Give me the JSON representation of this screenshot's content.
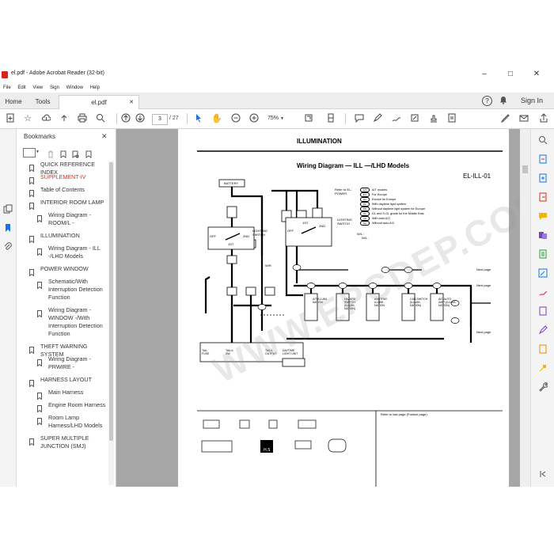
{
  "window": {
    "title": "el.pdf - Adobe Acrobat Reader (32-bit)",
    "minimize": "–",
    "maximize": "□",
    "close": "✕"
  },
  "menu": [
    "File",
    "Edit",
    "View",
    "Sign",
    "Window",
    "Help"
  ],
  "tabs": {
    "home": "Home",
    "tools": "Tools",
    "doc": "el.pdf",
    "doc_close": "✕",
    "help": "?",
    "bell": "🔔",
    "signin": "Sign In"
  },
  "toolbar": {
    "page_current": "3",
    "page_sep": "/",
    "page_total": "27",
    "zoom": "75%"
  },
  "bookmarks": {
    "title": "Bookmarks",
    "close": "✕",
    "items": [
      {
        "label": "QUICK REFERENCE INDEX",
        "level": 0,
        "color": "#333"
      },
      {
        "label": "SUPPLEMENT-IV",
        "level": 0,
        "color": "#d6311f"
      },
      {
        "label": "Table of Contents",
        "level": 0,
        "color": "#333"
      },
      {
        "label": "INTERIOR ROOM LAMP",
        "level": 0,
        "color": "#333"
      },
      {
        "label": "Wiring Diagram - ROOM/L -",
        "level": 1,
        "color": "#333"
      },
      {
        "label": "ILLUMINATION",
        "level": 0,
        "color": "#333"
      },
      {
        "label": "Wiring Diagram - ILL -/LHD Models",
        "level": 1,
        "color": "#333"
      },
      {
        "label": "POWER WINDOW",
        "level": 0,
        "color": "#333"
      },
      {
        "label": "Schematic/With Interruption Detection Function",
        "level": 1,
        "color": "#333"
      },
      {
        "label": "Wiring Diagram - WINDOW -/With Interruption Detection Function",
        "level": 1,
        "color": "#333"
      },
      {
        "label": "THEFT WARNING SYSTEM",
        "level": 0,
        "color": "#333"
      },
      {
        "label": "Wiring Diagram - PRWIRE -",
        "level": 1,
        "color": "#333"
      },
      {
        "label": "HARNESS LAYOUT",
        "level": 0,
        "color": "#333"
      },
      {
        "label": "Main Harness",
        "level": 1,
        "color": "#333"
      },
      {
        "label": "Engine Room Harness",
        "level": 1,
        "color": "#333"
      },
      {
        "label": "Room Lamp Harness/LHD Models",
        "level": 1,
        "color": "#333"
      },
      {
        "label": "SUPER MULTIPLE JUNCTION (SMJ)",
        "level": 0,
        "color": "#333"
      }
    ]
  },
  "doc": {
    "header": "ILLUMINATION",
    "title": "Wiring Diagram — ILL —/LHD Models",
    "code": "EL-ILL-01",
    "battery": "BATTERY",
    "refer_power": "Refer to EL-POWER.",
    "lighting_switch": "LIGHTING SWITCH",
    "off": "OFF",
    "first": "1ST",
    "second": "2ND",
    "wr": "W/R",
    "next_page_1": "Next page",
    "next_page_2": "Next page",
    "next_page_3": "Next page",
    "components": [
      "A/T ILLUMI-NATION",
      "HAZARD SWITCH (ILLUMI-NATION)",
      "ASHTRAY ILLUMI-NATION",
      "CAN SWITCH (ILLUMI-NATION)",
      "A/C AUTO AMP (ILLUMI-NATION)"
    ],
    "bottom_labels": [
      "TAIL FUSE",
      "TAIL/L SW",
      "TAIL/L OUTPUT",
      "DAYTIME LIGHT UNIT"
    ],
    "legend": [
      {
        "code": "A/T",
        "text": "A/T models"
      },
      {
        "code": "EU",
        "text": "For Europe"
      },
      {
        "code": "EX",
        "text": "Except for Europe"
      },
      {
        "code": "DL",
        "text": "With daytime light system"
      },
      {
        "code": "DN",
        "text": "Without daytime light system for Europe"
      },
      {
        "code": "GL",
        "text": "GL and S-GL grade for the Middle East"
      },
      {
        "code": "AA",
        "text": "With auto A/C"
      },
      {
        "code": "NA",
        "text": "Without auto A/C"
      }
    ],
    "legend_wh": "W/L :",
    "legend_wl": "W/L :",
    "footer_ref": "Refer to last page (Foldout page).",
    "watermark": "WWW.EPCDEP.COM"
  }
}
